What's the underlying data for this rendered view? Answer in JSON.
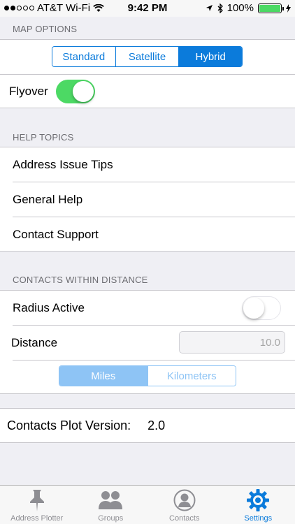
{
  "status": {
    "carrier": "AT&T Wi-Fi",
    "time": "9:42 PM",
    "battery": "100%",
    "signal_bars_filled": 2,
    "signal_bars_total": 5
  },
  "map_options": {
    "header": "MAP OPTIONS",
    "segments": [
      "Standard",
      "Satellite",
      "Hybrid"
    ],
    "selected": "Hybrid",
    "flyover_label": "Flyover",
    "flyover_on": true
  },
  "help_topics": {
    "header": "HELP TOPICS",
    "items": [
      "Address Issue Tips",
      "General Help",
      "Contact Support"
    ]
  },
  "contacts_within_distance": {
    "header": "CONTACTS WITHIN DISTANCE",
    "radius_label": "Radius Active",
    "radius_on": false,
    "distance_label": "Distance",
    "distance_placeholder": "10.0",
    "units": [
      "Miles",
      "Kilometers"
    ],
    "selected_unit": "Miles"
  },
  "version": {
    "label": "Contacts Plot Version:",
    "value": "2.0"
  },
  "tabs": [
    {
      "label": "Address Plotter",
      "icon": "pushpin-icon"
    },
    {
      "label": "Groups",
      "icon": "groups-icon"
    },
    {
      "label": "Contacts",
      "icon": "contact-icon"
    },
    {
      "label": "Settings",
      "icon": "gear-icon"
    }
  ],
  "active_tab": "Settings",
  "colors": {
    "accent": "#0b7bdb",
    "toggle_on": "#4cd964",
    "inactive_tab": "#8e8e93"
  }
}
